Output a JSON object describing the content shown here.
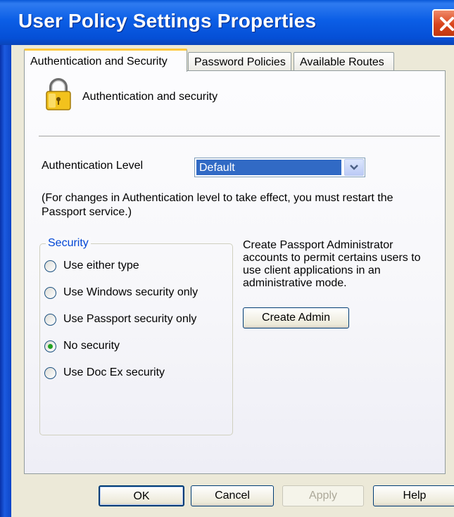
{
  "window": {
    "title": "User Policy Settings Properties"
  },
  "tabs": [
    {
      "label": "Authentication and Security",
      "active": true
    },
    {
      "label": "Password Policies",
      "active": false
    },
    {
      "label": "Available Routes",
      "active": false
    }
  ],
  "panel": {
    "header_text": "Authentication and security",
    "header_icon": "padlock-icon",
    "auth_level_label": "Authentication Level",
    "auth_level_value": "Default",
    "note": "(For changes in Authentication level to take effect, you must restart the Passport service.)",
    "security_group": {
      "title": "Security",
      "options": [
        {
          "label": "Use either type",
          "checked": false
        },
        {
          "label": "Use Windows security only",
          "checked": false
        },
        {
          "label": "Use Passport security only",
          "checked": false
        },
        {
          "label": "No security",
          "checked": true
        },
        {
          "label": "Use Doc Ex security",
          "checked": false
        }
      ]
    },
    "admin_description": "Create Passport Administrator accounts to permit certains users to use client applications in an administrative mode.",
    "create_admin_label": "Create Admin"
  },
  "buttons": {
    "ok": "OK",
    "cancel": "Cancel",
    "apply": "Apply",
    "help": "Help"
  },
  "colors": {
    "titlebar": "#0b5ee6",
    "tab_highlight": "#ffc83c",
    "group_title": "#0046d5",
    "selection": "#316ac5",
    "radio_dot": "#21a121"
  }
}
